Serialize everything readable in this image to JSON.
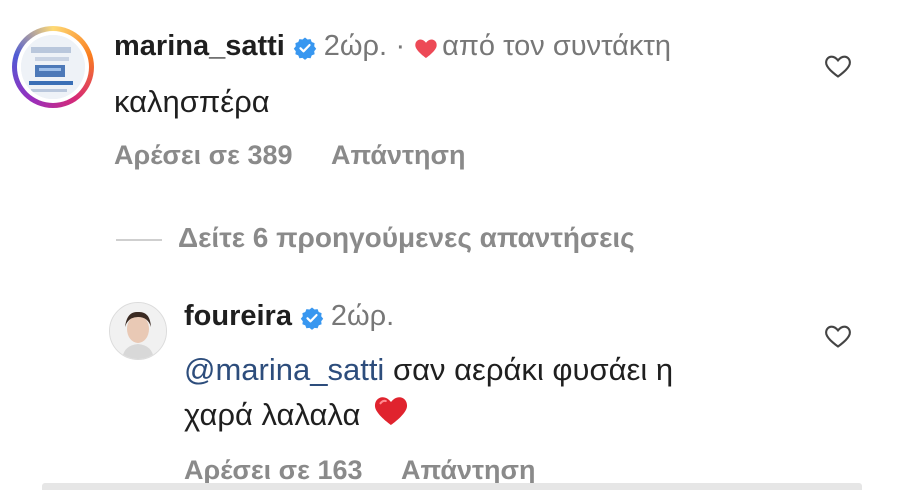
{
  "comment1": {
    "username": "marina_satti",
    "time": "2ώρ.",
    "separator": "·",
    "liked_by_author_text": "από τον συντάκτη",
    "text": "καλησπέρα",
    "likes_label": "Αρέσει σε 389",
    "reply_label": "Απάντηση"
  },
  "view_replies": {
    "label": "Δείτε 6 προηγούμενες απαντήσεις"
  },
  "comment2": {
    "username": "foureira",
    "time": "2ώρ.",
    "mention": "@marina_satti",
    "text_line1": " σαν αεράκι φυσάει η",
    "text_line2": "χαρά λαλαλα",
    "emoji": "❤️",
    "likes_label": "Αρέσει σε 163",
    "reply_label": "Απάντηση"
  },
  "colors": {
    "verified_blue": "#3897f0",
    "author_heart": "#ed4956",
    "mention": "#2d4d7c",
    "secondary_text": "#8a8a8a"
  },
  "icons": [
    "verified-badge-icon",
    "heart-outline-icon",
    "red-heart-icon"
  ]
}
